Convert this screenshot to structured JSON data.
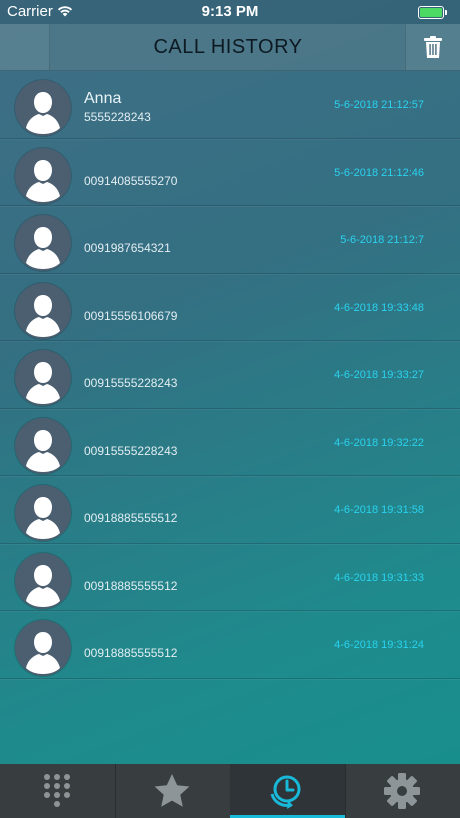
{
  "status_bar": {
    "carrier": "Carrier",
    "time": "9:13 PM"
  },
  "header": {
    "title": "CALL HISTORY"
  },
  "calls": [
    {
      "name": "Anna",
      "number": "5555228243",
      "date": "5-6-2018 21:12:57"
    },
    {
      "name": "",
      "number": "00914085555270",
      "date": "5-6-2018 21:12:46"
    },
    {
      "name": "",
      "number": "0091987654321",
      "date": "5-6-2018 21:12:7"
    },
    {
      "name": "",
      "number": "00915556106679",
      "date": "4-6-2018 19:33:48"
    },
    {
      "name": "",
      "number": "00915555228243",
      "date": "4-6-2018 19:33:27"
    },
    {
      "name": "",
      "number": "00915555228243",
      "date": "4-6-2018 19:32:22"
    },
    {
      "name": "",
      "number": "00918885555512",
      "date": "4-6-2018 19:31:58"
    },
    {
      "name": "",
      "number": "00918885555512",
      "date": "4-6-2018 19:31:33"
    },
    {
      "name": "",
      "number": "00918885555512",
      "date": "4-6-2018 19:31:24"
    }
  ],
  "tabs": [
    {
      "icon": "keypad-icon",
      "active": false
    },
    {
      "icon": "star-icon",
      "active": false
    },
    {
      "icon": "history-icon",
      "active": true
    },
    {
      "icon": "gear-icon",
      "active": false
    }
  ],
  "colors": {
    "accent": "#2ad2ef",
    "battery": "#4cd964",
    "tab_bar": "#383d40"
  }
}
